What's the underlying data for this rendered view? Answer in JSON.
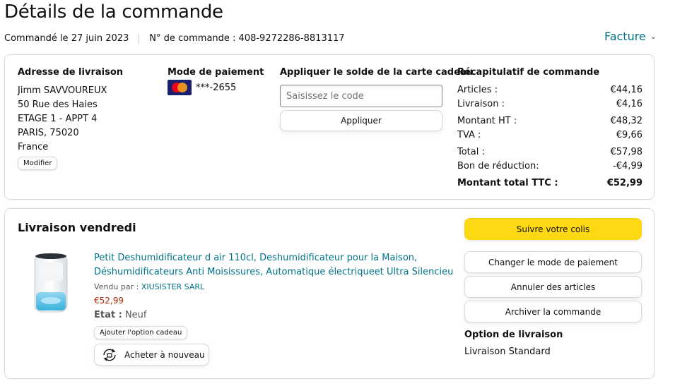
{
  "header": {
    "title": "Détails de la commande",
    "ordered_on": "Commandé le 27 juin 2023",
    "order_number": "N° de commande : 408-9272286-8813117",
    "invoice_label": "Facture"
  },
  "shipping": {
    "title": "Adresse de livraison",
    "lines": [
      "Jimm SAVVOUREUX",
      "50 Rue des Haies",
      "ETAGE 1 - APPT 4",
      "PARIS, 75020",
      "France"
    ],
    "modify_label": "Modifier"
  },
  "payment": {
    "title": "Mode de paiement",
    "card_icon": "mastercard-icon",
    "card_number": "***-2655"
  },
  "gift_card": {
    "title": "Appliquer le solde de la carte cadeau",
    "placeholder": "Saisissez le code",
    "apply_label": "Appliquer"
  },
  "summary": {
    "title": "Récapitulatif de commande",
    "rows": [
      {
        "label": "Articles :",
        "value": "€44,16"
      },
      {
        "label": "Livraison :",
        "value": "€4,16"
      },
      {
        "label": "Montant HT :",
        "value": "€48,32"
      },
      {
        "label": "TVA :",
        "value": "€9,66"
      },
      {
        "label": "Total :",
        "value": "€57,98"
      },
      {
        "label": "Bon de réduction:",
        "value": "-€4,99"
      }
    ],
    "grand_total_label": "Montant total TTC :",
    "grand_total_value": "€52,99"
  },
  "delivery": {
    "title": "Livraison vendredi",
    "product_title": "Petit Deshumidificateur d air 110cl, Deshumidificateur pour la Maison, Déshumidificateurs Anti Moisissures, Automatique électriqueet Ultra Silencieu",
    "vendor_label": "Vendu par :",
    "vendor_name": "XIUSISTER SARL",
    "price": "€52,99",
    "state_label": "Etat :",
    "state_value": "Neuf",
    "gift_option_label": "Ajouter l'option cadeau",
    "buy_again_label": "Acheter à nouveau",
    "track_label": "Suivre votre colis",
    "change_payment_label": "Changer le mode de paiement",
    "cancel_label": "Annuler des articles",
    "archive_label": "Archiver la commande",
    "option_title": "Option de livraison",
    "option_value": "Livraison Standard"
  },
  "colors": {
    "link": "#007185",
    "price": "#b12704",
    "primary_button": "#ffd814"
  }
}
